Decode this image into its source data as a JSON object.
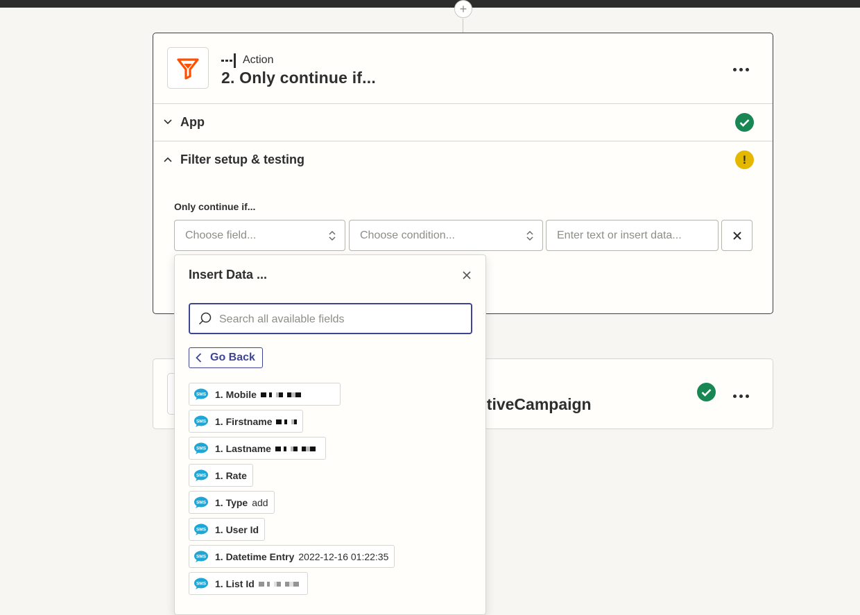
{
  "action_card": {
    "step_kind": "Action",
    "step_title": "2. Only continue if...",
    "sections": [
      {
        "label": "App",
        "status": "complete"
      },
      {
        "label": "Filter setup & testing",
        "status": "warning"
      }
    ],
    "warning_glyph": "!",
    "filter": {
      "label": "Only continue if...",
      "field_placeholder": "Choose field...",
      "condition_placeholder": "Choose condition...",
      "value_placeholder": "Enter text or insert data..."
    }
  },
  "next_step": {
    "title_partial": "ctiveCampaign",
    "status": "complete"
  },
  "insert_data": {
    "title": "Insert Data ...",
    "search_placeholder": "Search all available fields",
    "go_back_label": "Go Back",
    "fields": [
      {
        "name": "1. Mobile",
        "value": "",
        "redacted": true
      },
      {
        "name": "1. Firstname",
        "value": "",
        "redacted": true
      },
      {
        "name": "1. Lastname",
        "value": "",
        "redacted": true
      },
      {
        "name": "1. Rate",
        "value": ""
      },
      {
        "name": "1. Type",
        "value": "add"
      },
      {
        "name": "1. User Id",
        "value": ""
      },
      {
        "name": "1. Datetime Entry",
        "value": "2022-12-16 01:22:35"
      },
      {
        "name": "1. List Id",
        "value": "",
        "redacted": true
      }
    ]
  },
  "colors": {
    "accent": "#3d4592",
    "success": "#198754",
    "warning": "#e5b800",
    "filter_brand": "#ff4f00",
    "sms_badge": "#1ea7d6"
  },
  "icons": {
    "filter_app": "filter-funnel-icon",
    "field_source": "sms-bubble-icon"
  }
}
